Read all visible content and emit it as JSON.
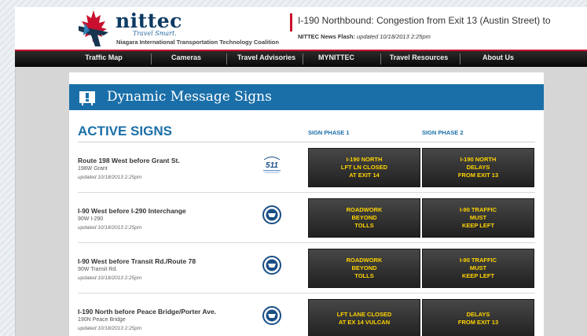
{
  "header": {
    "brand": "nittec",
    "tagline": "Travel Smart.",
    "org_full": "Niagara International Transportation Technology Coalition",
    "alert": "I-190 Northbound: Congestion from Exit 13 (Austin Street) to",
    "flash_label": "NITTEC News Flash:",
    "flash_updated": "updated 10/18/2013 2:25pm"
  },
  "nav": {
    "items": [
      "Traffic Map",
      "Cameras",
      "Travel Advisories",
      "MYNITTEC",
      "Travel Resources",
      "About Us"
    ]
  },
  "section": {
    "title": "Dynamic Message Signs",
    "active_title": "ACTIVE SIGNS",
    "phase1": "SIGN PHASE 1",
    "phase2": "SIGN PHASE 2"
  },
  "signs": [
    {
      "name": "Route 198 West before Grant St.",
      "code": "198W Grant",
      "updated": "updated 10/18/2013 2:25pm",
      "agency": "511-icon",
      "agency_label": "511",
      "phase1": [
        "I-190 NORTH",
        "LFT LN CLOSED",
        "AT EXIT 14"
      ],
      "phase2": [
        "I-190 NORTH",
        "DELAYS",
        "FROM EXIT 13"
      ]
    },
    {
      "name": "I-90 West before I-290 Interchange",
      "code": "90W I-290",
      "updated": "updated 10/18/2013 2:25pm",
      "agency": "nys-thruway-icon",
      "phase1": [
        "ROADWORK",
        "BEYOND",
        "TOLLS"
      ],
      "phase2": [
        "I-90 TRAFFIC",
        "MUST",
        "KEEP LEFT"
      ]
    },
    {
      "name": "I-90 West before Transit Rd./Route 78",
      "code": "90W Transit Rd.",
      "updated": "updated 10/18/2013 2:25pm",
      "agency": "nys-thruway-icon",
      "phase1": [
        "ROADWORK",
        "BEYOND",
        "TOLLS"
      ],
      "phase2": [
        "I-90 TRAFFIC",
        "MUST",
        "KEEP LEFT"
      ]
    },
    {
      "name": "I-190 North before Peace Bridge/Porter Ave.",
      "code": "190N Peace Bridge",
      "updated": "updated 10/18/2013 2:25pm",
      "agency": "nys-thruway-icon",
      "phase1": [
        "LFT LANE CLOSED",
        "AT EX 14 VULCAN"
      ],
      "phase2": [
        "DELAYS",
        "FROM EXIT 13"
      ]
    }
  ],
  "colors": {
    "brand_blue": "#1a6fa8",
    "sign_text": "#ffd400",
    "alert_red": "#c8102e"
  }
}
